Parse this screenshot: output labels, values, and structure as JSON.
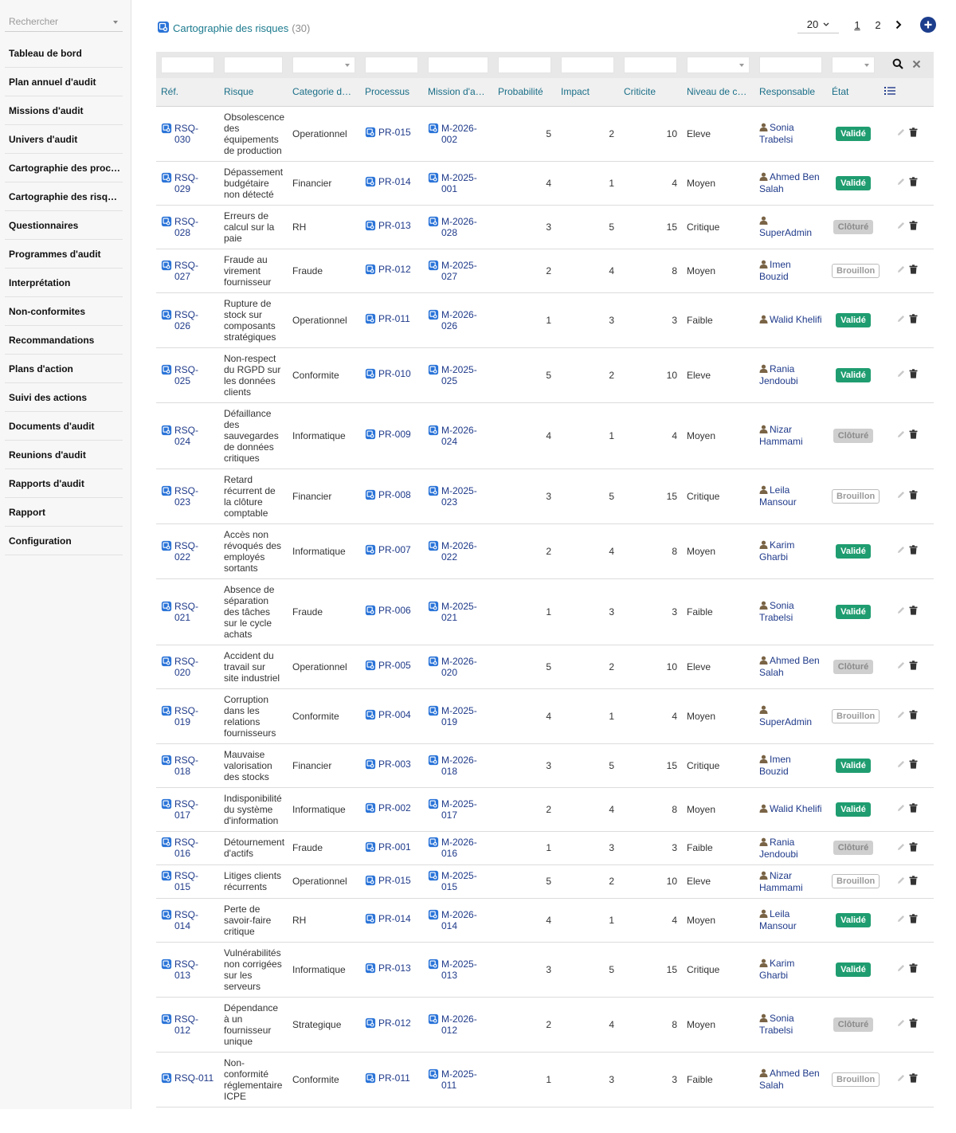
{
  "sidebar": {
    "search_placeholder": "Rechercher",
    "items": [
      {
        "label": "Tableau de bord"
      },
      {
        "label": "Plan annuel d'audit"
      },
      {
        "label": "Missions d'audit"
      },
      {
        "label": "Univers d'audit"
      },
      {
        "label": "Cartographie des processus"
      },
      {
        "label": "Cartographie des risques"
      },
      {
        "label": "Questionnaires"
      },
      {
        "label": "Programmes d'audit"
      },
      {
        "label": "Interprétation"
      },
      {
        "label": "Non-conformites"
      },
      {
        "label": "Recommandations"
      },
      {
        "label": "Plans d'action"
      },
      {
        "label": "Suivi des actions"
      },
      {
        "label": "Documents d'audit"
      },
      {
        "label": "Reunions d'audit"
      },
      {
        "label": "Rapports d'audit"
      },
      {
        "label": "Rapport"
      },
      {
        "label": "Configuration"
      }
    ]
  },
  "header": {
    "title": "Cartographie des risques",
    "count": "(30)",
    "page_size": "20",
    "pages": [
      "1",
      "2"
    ],
    "current_page": "1"
  },
  "colors": {
    "accent": "#1b7a8e",
    "link": "#1f3a8a",
    "valide": "#1f9d70",
    "cloture": "#cfcfcf",
    "add_button": "#1c3d8c"
  },
  "icons": {
    "ref": "record-link-icon",
    "user": "user-icon",
    "edit": "pencil-icon",
    "delete": "trash-icon",
    "search": "search-icon",
    "clear": "close-icon",
    "columns": "list-icon",
    "add": "plus-circle-icon",
    "next": "chevron-right-icon"
  },
  "table": {
    "columns": [
      "Réf.",
      "Risque",
      "Categorie de risque",
      "Processus",
      "Mission d'audit",
      "Probabilité",
      "Impact",
      "Criticite",
      "Niveau de criticite",
      "Responsable",
      "État"
    ],
    "rows": [
      {
        "ref": "RSQ-030",
        "risque": "Obsolescence des équipements de production",
        "categorie": "Operationnel",
        "processus": "PR-015",
        "mission": "M-2026-002",
        "probabilite": "5",
        "impact": "2",
        "criticite": "10",
        "niveau": "Eleve",
        "responsable": "Sonia Trabelsi",
        "etat": "Validé"
      },
      {
        "ref": "RSQ-029",
        "risque": "Dépassement budgétaire non détecté",
        "categorie": "Financier",
        "processus": "PR-014",
        "mission": "M-2025-001",
        "probabilite": "4",
        "impact": "1",
        "criticite": "4",
        "niveau": "Moyen",
        "responsable": "Ahmed Ben Salah",
        "etat": "Validé"
      },
      {
        "ref": "RSQ-028",
        "risque": "Erreurs de calcul sur la paie",
        "categorie": "RH",
        "processus": "PR-013",
        "mission": "M-2026-028",
        "probabilite": "3",
        "impact": "5",
        "criticite": "15",
        "niveau": "Critique",
        "responsable": "SuperAdmin",
        "etat": "Clôturé"
      },
      {
        "ref": "RSQ-027",
        "risque": "Fraude au virement fournisseur",
        "categorie": "Fraude",
        "processus": "PR-012",
        "mission": "M-2025-027",
        "probabilite": "2",
        "impact": "4",
        "criticite": "8",
        "niveau": "Moyen",
        "responsable": "Imen Bouzid",
        "etat": "Brouillon"
      },
      {
        "ref": "RSQ-026",
        "risque": "Rupture de stock sur composants stratégiques",
        "categorie": "Operationnel",
        "processus": "PR-011",
        "mission": "M-2026-026",
        "probabilite": "1",
        "impact": "3",
        "criticite": "3",
        "niveau": "Faible",
        "responsable": "Walid Khelifi",
        "etat": "Validé"
      },
      {
        "ref": "RSQ-025",
        "risque": "Non-respect du RGPD sur les données clients",
        "categorie": "Conformite",
        "processus": "PR-010",
        "mission": "M-2025-025",
        "probabilite": "5",
        "impact": "2",
        "criticite": "10",
        "niveau": "Eleve",
        "responsable": "Rania Jendoubi",
        "etat": "Validé"
      },
      {
        "ref": "RSQ-024",
        "risque": "Défaillance des sauvegardes de données critiques",
        "categorie": "Informatique",
        "processus": "PR-009",
        "mission": "M-2026-024",
        "probabilite": "4",
        "impact": "1",
        "criticite": "4",
        "niveau": "Moyen",
        "responsable": "Nizar Hammami",
        "etat": "Clôturé"
      },
      {
        "ref": "RSQ-023",
        "risque": "Retard récurrent de la clôture comptable",
        "categorie": "Financier",
        "processus": "PR-008",
        "mission": "M-2025-023",
        "probabilite": "3",
        "impact": "5",
        "criticite": "15",
        "niveau": "Critique",
        "responsable": "Leila Mansour",
        "etat": "Brouillon"
      },
      {
        "ref": "RSQ-022",
        "risque": "Accès non révoqués des employés sortants",
        "categorie": "Informatique",
        "processus": "PR-007",
        "mission": "M-2026-022",
        "probabilite": "2",
        "impact": "4",
        "criticite": "8",
        "niveau": "Moyen",
        "responsable": "Karim Gharbi",
        "etat": "Validé"
      },
      {
        "ref": "RSQ-021",
        "risque": "Absence de séparation des tâches sur le cycle achats",
        "categorie": "Fraude",
        "processus": "PR-006",
        "mission": "M-2025-021",
        "probabilite": "1",
        "impact": "3",
        "criticite": "3",
        "niveau": "Faible",
        "responsable": "Sonia Trabelsi",
        "etat": "Validé"
      },
      {
        "ref": "RSQ-020",
        "risque": "Accident du travail sur site industriel",
        "categorie": "Operationnel",
        "processus": "PR-005",
        "mission": "M-2026-020",
        "probabilite": "5",
        "impact": "2",
        "criticite": "10",
        "niveau": "Eleve",
        "responsable": "Ahmed Ben Salah",
        "etat": "Clôturé"
      },
      {
        "ref": "RSQ-019",
        "risque": "Corruption dans les relations fournisseurs",
        "categorie": "Conformite",
        "processus": "PR-004",
        "mission": "M-2025-019",
        "probabilite": "4",
        "impact": "1",
        "criticite": "4",
        "niveau": "Moyen",
        "responsable": "SuperAdmin",
        "etat": "Brouillon"
      },
      {
        "ref": "RSQ-018",
        "risque": "Mauvaise valorisation des stocks",
        "categorie": "Financier",
        "processus": "PR-003",
        "mission": "M-2026-018",
        "probabilite": "3",
        "impact": "5",
        "criticite": "15",
        "niveau": "Critique",
        "responsable": "Imen Bouzid",
        "etat": "Validé"
      },
      {
        "ref": "RSQ-017",
        "risque": "Indisponibilité du système d'information",
        "categorie": "Informatique",
        "processus": "PR-002",
        "mission": "M-2025-017",
        "probabilite": "2",
        "impact": "4",
        "criticite": "8",
        "niveau": "Moyen",
        "responsable": "Walid Khelifi",
        "etat": "Validé"
      },
      {
        "ref": "RSQ-016",
        "risque": "Détournement d'actifs",
        "categorie": "Fraude",
        "processus": "PR-001",
        "mission": "M-2026-016",
        "probabilite": "1",
        "impact": "3",
        "criticite": "3",
        "niveau": "Faible",
        "responsable": "Rania Jendoubi",
        "etat": "Clôturé"
      },
      {
        "ref": "RSQ-015",
        "risque": "Litiges clients récurrents",
        "categorie": "Operationnel",
        "processus": "PR-015",
        "mission": "M-2025-015",
        "probabilite": "5",
        "impact": "2",
        "criticite": "10",
        "niveau": "Eleve",
        "responsable": "Nizar Hammami",
        "etat": "Brouillon"
      },
      {
        "ref": "RSQ-014",
        "risque": "Perte de savoir-faire critique",
        "categorie": "RH",
        "processus": "PR-014",
        "mission": "M-2026-014",
        "probabilite": "4",
        "impact": "1",
        "criticite": "4",
        "niveau": "Moyen",
        "responsable": "Leila Mansour",
        "etat": "Validé"
      },
      {
        "ref": "RSQ-013",
        "risque": "Vulnérabilités non corrigées sur les serveurs",
        "categorie": "Informatique",
        "processus": "PR-013",
        "mission": "M-2025-013",
        "probabilite": "3",
        "impact": "5",
        "criticite": "15",
        "niveau": "Critique",
        "responsable": "Karim Gharbi",
        "etat": "Validé"
      },
      {
        "ref": "RSQ-012",
        "risque": "Dépendance à un fournisseur unique",
        "categorie": "Strategique",
        "processus": "PR-012",
        "mission": "M-2026-012",
        "probabilite": "2",
        "impact": "4",
        "criticite": "8",
        "niveau": "Moyen",
        "responsable": "Sonia Trabelsi",
        "etat": "Clôturé"
      },
      {
        "ref": "RSQ-011",
        "risque": "Non-conformité réglementaire ICPE",
        "categorie": "Conformite",
        "processus": "PR-011",
        "mission": "M-2025-011",
        "probabilite": "1",
        "impact": "3",
        "criticite": "3",
        "niveau": "Faible",
        "responsable": "Ahmed Ben Salah",
        "etat": "Brouillon"
      }
    ]
  }
}
